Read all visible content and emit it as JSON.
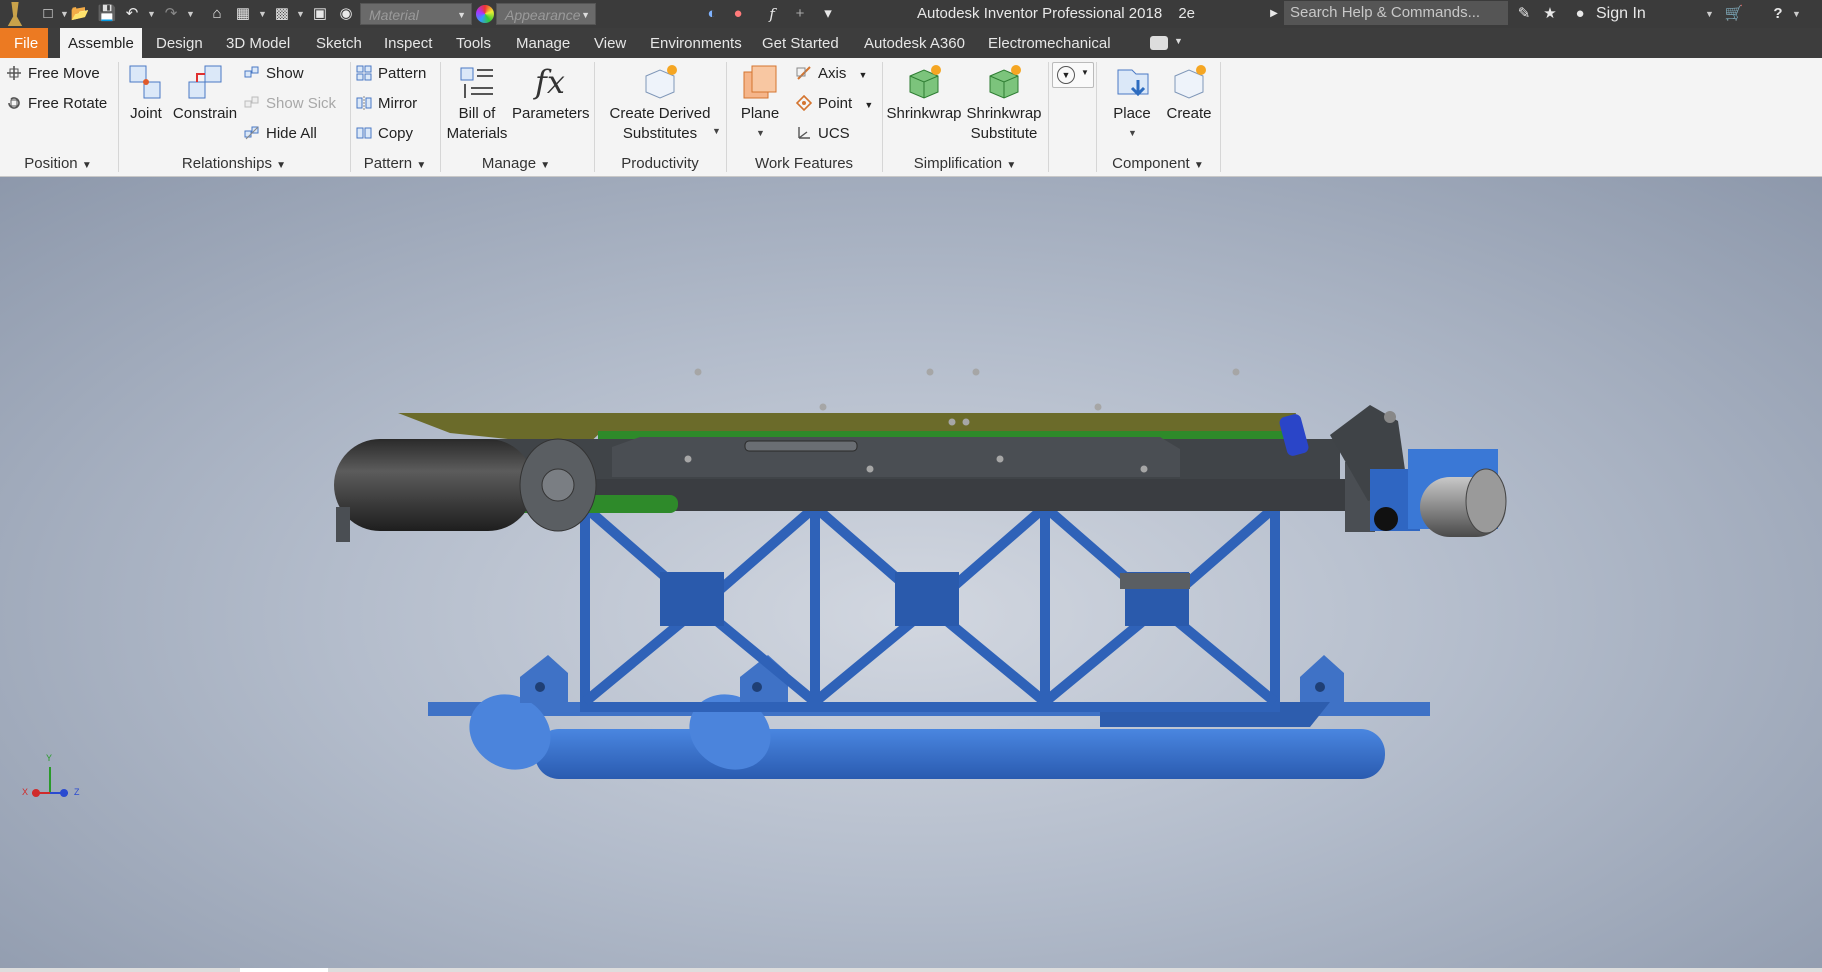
{
  "app": {
    "title": "Autodesk Inventor Professional 2018",
    "document": "2e"
  },
  "quick_access": {
    "material_placeholder": "Material",
    "appearance_placeholder": "Appearance",
    "search_placeholder": "Search Help & Commands...",
    "sign_in": "Sign In"
  },
  "tabs": [
    {
      "label": "File"
    },
    {
      "label": "Assemble"
    },
    {
      "label": "Design"
    },
    {
      "label": "3D Model"
    },
    {
      "label": "Sketch"
    },
    {
      "label": "Inspect"
    },
    {
      "label": "Tools"
    },
    {
      "label": "Manage"
    },
    {
      "label": "View"
    },
    {
      "label": "Environments"
    },
    {
      "label": "Get Started"
    },
    {
      "label": "Autodesk A360"
    },
    {
      "label": "Electromechanical"
    }
  ],
  "ribbon": {
    "position": {
      "label": "Position",
      "free_move": "Free Move",
      "free_rotate": "Free Rotate"
    },
    "relationships": {
      "label": "Relationships",
      "joint": "Joint",
      "constrain": "Constrain",
      "show": "Show",
      "show_sick": "Show Sick",
      "hide_all": "Hide All"
    },
    "pattern": {
      "label": "Pattern",
      "pattern": "Pattern",
      "mirror": "Mirror",
      "copy": "Copy"
    },
    "manage": {
      "label": "Manage",
      "bom_line1": "Bill of",
      "bom_line2": "Materials",
      "parameters": "Parameters"
    },
    "productivity": {
      "label": "Productivity",
      "derived_line1": "Create Derived",
      "derived_line2": "Substitutes"
    },
    "work_features": {
      "label": "Work Features",
      "plane": "Plane",
      "axis": "Axis",
      "point": "Point",
      "ucs": "UCS"
    },
    "simplification": {
      "label": "Simplification",
      "shrinkwrap": "Shrinkwrap",
      "shrinkwrap_sub_line1": "Shrinkwrap",
      "shrinkwrap_sub_line2": "Substitute"
    },
    "component": {
      "label": "Component",
      "place": "Place",
      "create": "Create"
    }
  },
  "triad": {
    "x": "X",
    "y": "Y",
    "z": "Z"
  },
  "colors": {
    "accent": "#ec7a22",
    "model_blue": "#3a6fc4",
    "model_dark": "#404448",
    "model_green": "#2e8a2a"
  }
}
